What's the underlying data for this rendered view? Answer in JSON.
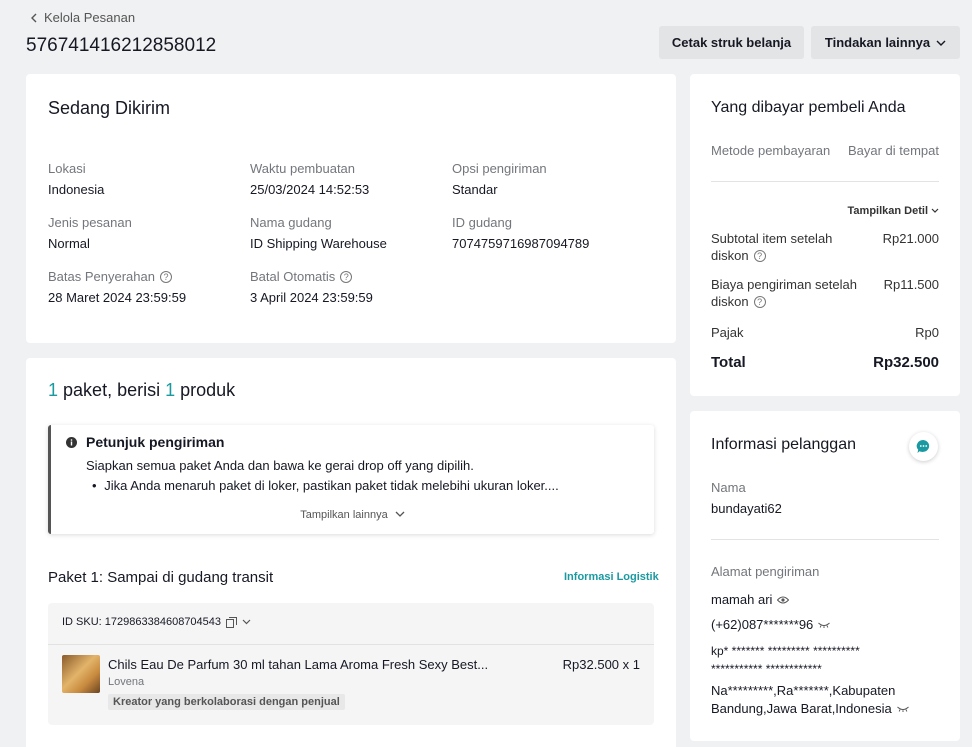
{
  "header": {
    "back_label": "Kelola Pesanan",
    "order_id": "576741416212858012",
    "print_button": "Cetak struk belanja",
    "more_actions_button": "Tindakan lainnya"
  },
  "status_card": {
    "title": "Sedang Dikirim",
    "fields": {
      "location_label": "Lokasi",
      "location_value": "Indonesia",
      "created_label": "Waktu pembuatan",
      "created_value": "25/03/2024 14:52:53",
      "shipping_option_label": "Opsi pengiriman",
      "shipping_option_value": "Standar",
      "order_type_label": "Jenis pesanan",
      "order_type_value": "Normal",
      "warehouse_name_label": "Nama gudang",
      "warehouse_name_value": "ID Shipping Warehouse",
      "warehouse_id_label": "ID gudang",
      "warehouse_id_value": "7074759716987094789",
      "handover_label": "Batas Penyerahan",
      "handover_value": "28 Maret 2024 23:59:59",
      "auto_cancel_label": "Batal Otomatis",
      "auto_cancel_value": "3 April 2024 23:59:59"
    }
  },
  "package_card": {
    "count_pkg": "1",
    "pkg_text": "paket, berisi",
    "count_product": "1",
    "product_text": "produk",
    "notice": {
      "title": "Petunjuk pengiriman",
      "line1": "Siapkan semua paket Anda dan bawa ke gerai drop off yang dipilih.",
      "bullet1": "Jika Anda menaruh paket di loker, pastikan paket tidak melebihi ukuran loker....",
      "show_more": "Tampilkan lainnya"
    },
    "package_title": "Paket 1: Sampai di gudang transit",
    "logistics_link": "Informasi Logistik",
    "sku_label": "ID SKU: 1729863384608704543",
    "product": {
      "name": "Chils Eau De Parfum 30 ml tahan Lama Aroma Fresh Sexy Best...",
      "variant": "Lovena",
      "tag": "Kreator yang berkolaborasi dengan penjual",
      "price_qty": "Rp32.500 x 1"
    }
  },
  "payment_card": {
    "title": "Yang dibayar pembeli Anda",
    "method_label": "Metode pembayaran",
    "method_value": "Bayar di tempat",
    "show_details": "Tampilkan Detil",
    "subtotal_label_1": "Subtotal item setelah",
    "subtotal_label_2": "diskon",
    "subtotal_value": "Rp21.000",
    "shipping_label_1": "Biaya pengiriman setelah",
    "shipping_label_2": "diskon",
    "shipping_value": "Rp11.500",
    "tax_label": "Pajak",
    "tax_value": "Rp0",
    "total_label": "Total",
    "total_value": "Rp32.500"
  },
  "customer_card": {
    "title": "Informasi pelanggan",
    "name_label": "Nama",
    "name_value": "bundayati62",
    "address_label": "Alamat pengiriman",
    "recipient": "mamah ari",
    "phone": "(+62)087*******96",
    "address_line1": "kp* ******* ********* **********",
    "address_line2": "*********** ************",
    "region_line1": "Na*********,Ra*******,Kabupaten",
    "region_line2": "Bandung,Jawa Barat,Indonesia"
  },
  "colors": {
    "accent": "#1a9aa0",
    "background": "#f0f1f2",
    "button_bg": "#e3e4e6"
  }
}
